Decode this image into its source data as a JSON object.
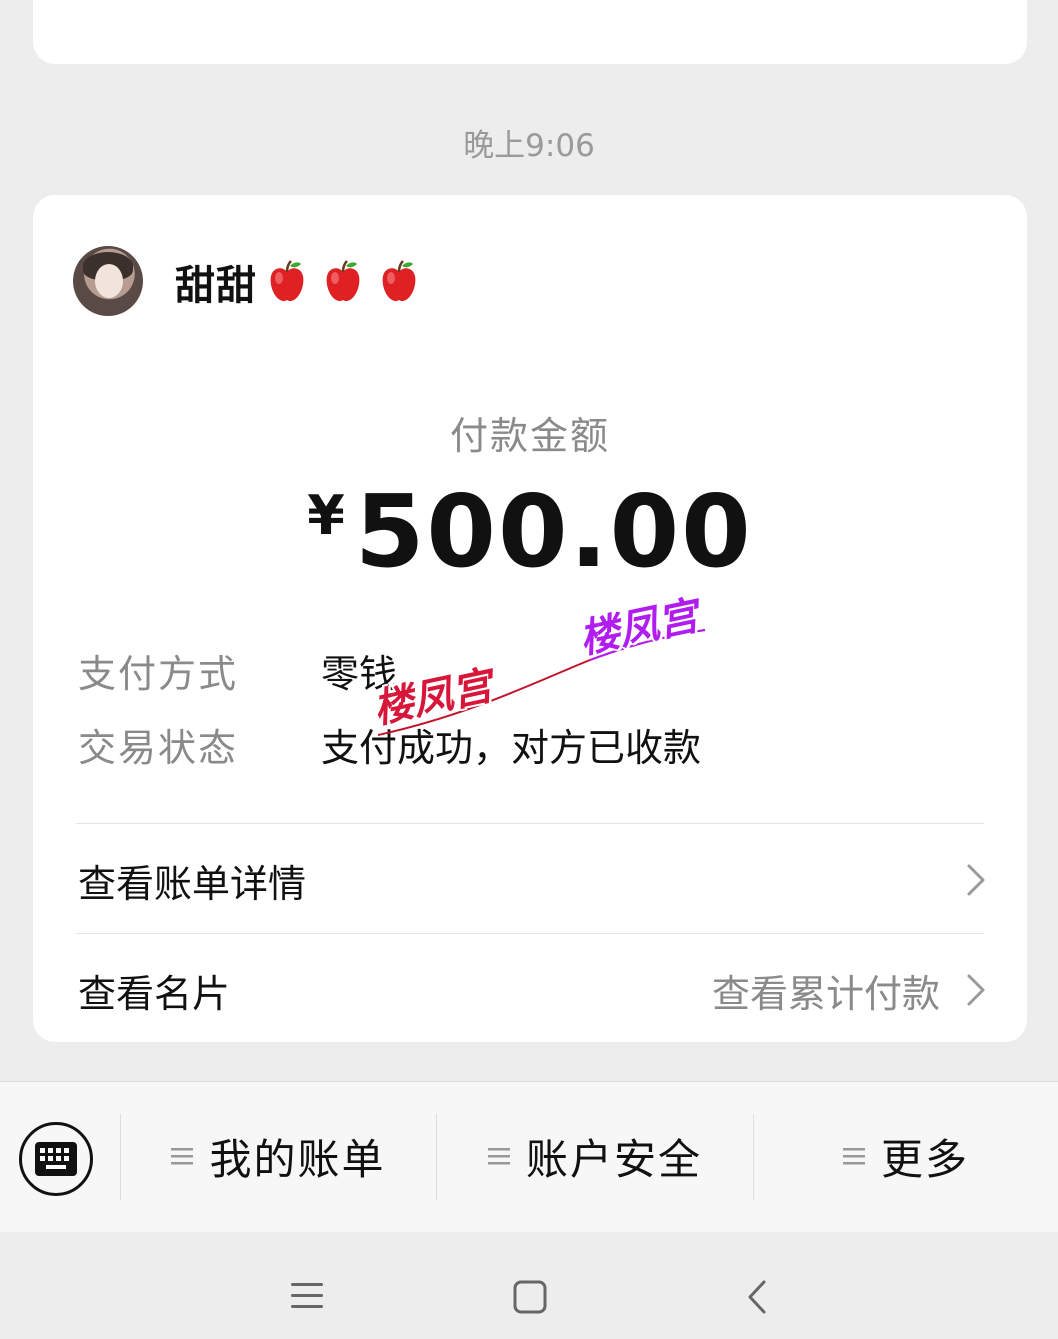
{
  "timestamp": "晚上9:06",
  "payer": {
    "name": "甜甜",
    "emoji_icons": [
      "apple-icon",
      "apple-icon",
      "apple-icon"
    ]
  },
  "payment": {
    "label": "付款金额",
    "currency": "¥",
    "amount": "500.00"
  },
  "details": [
    {
      "key": "支付方式",
      "value": "零钱"
    },
    {
      "key": "交易状态",
      "value": "支付成功，对方已收款"
    }
  ],
  "links": {
    "bill_details": "查看账单详情",
    "view_card": "查看名片",
    "view_total": "查看累计付款"
  },
  "watermark": "楼凤宫",
  "menu": {
    "items": [
      "我的账单",
      "账户安全",
      "更多"
    ]
  },
  "icons": {
    "keyboard": "keyboard-icon",
    "menu": "menu-lines-icon",
    "chevron": "chevron-right-icon",
    "nav": [
      "menu-icon",
      "home-square-icon",
      "back-icon"
    ]
  },
  "colors": {
    "background": "#ededed",
    "card": "#ffffff",
    "secondary_text": "#8a8a8a",
    "watermark_red": "#d8163a",
    "watermark_purple": "#b11df0"
  }
}
